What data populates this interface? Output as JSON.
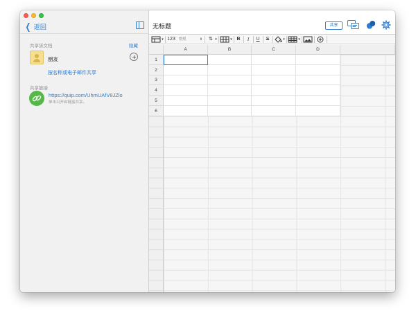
{
  "sidebar": {
    "back_label": "返回",
    "shared_doc_label": "共享该文档",
    "hide_label": "隐藏",
    "friend_name": "朋友",
    "invite_label": "按名称或电子邮件共享",
    "share_link_label": "共享链接",
    "share_link_url": "https://quip.com/UhmUAfV8JZlo",
    "share_link_hint": "单击以开启链接共享。"
  },
  "main": {
    "doc_title": "无标题",
    "share_button": "共享"
  },
  "toolbar": {
    "number_format": "123",
    "number_format_sub": "常规",
    "bold": "B",
    "italic": "I",
    "underline": "U",
    "strike": "S"
  },
  "grid": {
    "columns": [
      "A",
      "B",
      "C",
      "D"
    ],
    "rows": [
      "1",
      "2",
      "3",
      "4",
      "5",
      "6"
    ],
    "selected_cell": "A1"
  },
  "colors": {
    "accent": "#2f7fd3",
    "link_green": "#55b948",
    "sidebar_bg": "#f1f1f1"
  }
}
